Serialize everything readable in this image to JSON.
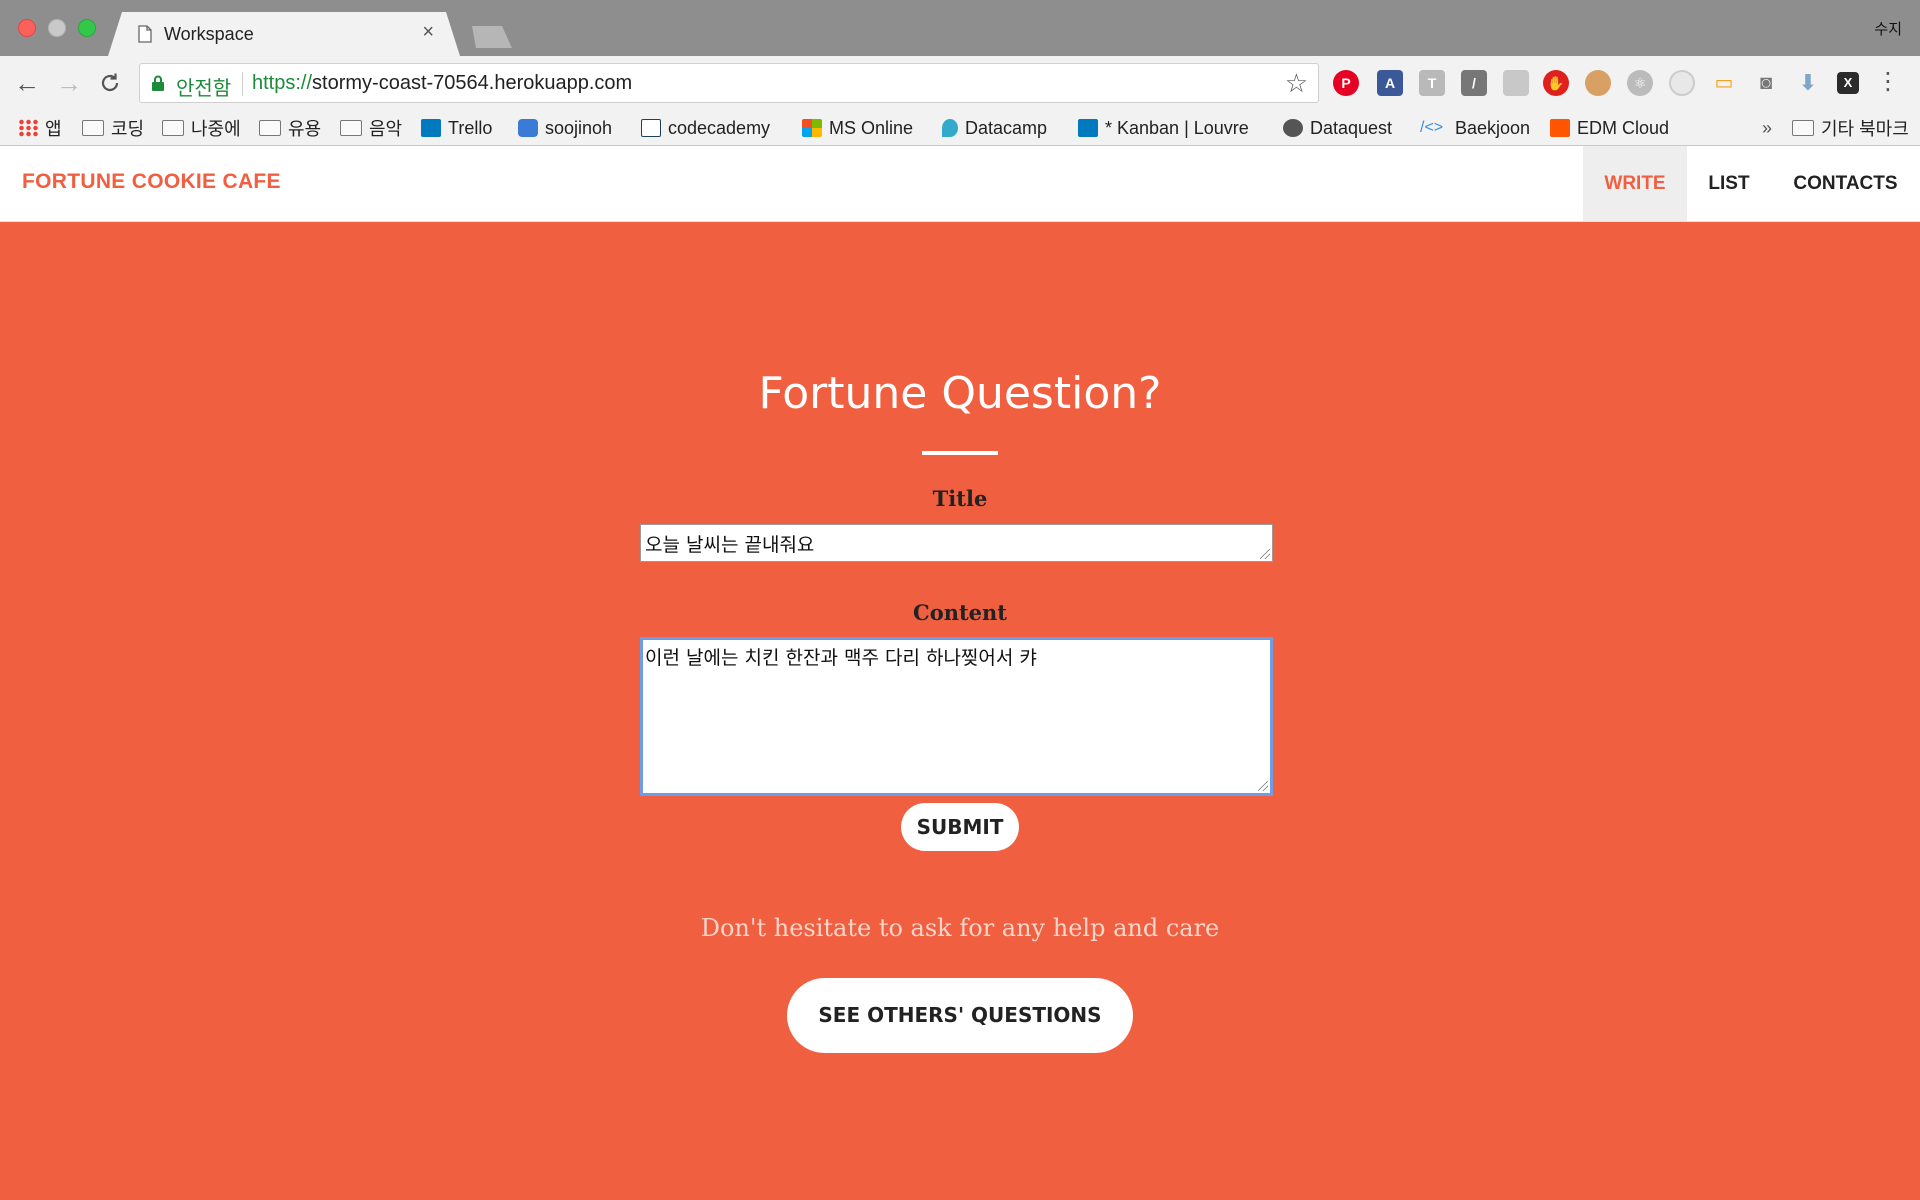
{
  "browser": {
    "tab_title": "Workspace",
    "tab_close": "×",
    "profile_name": "수지",
    "secure_label": "안전함",
    "url_scheme": "https://",
    "url_host": "stormy-coast-70564.herokuapp.com",
    "bookmarks": [
      {
        "label": "앱",
        "icon": "apps-grid-icon"
      },
      {
        "label": "코딩",
        "icon": "folder-icon"
      },
      {
        "label": "나중에",
        "icon": "folder-icon"
      },
      {
        "label": "유용",
        "icon": "folder-icon"
      },
      {
        "label": "음악",
        "icon": "folder-icon"
      },
      {
        "label": "Trello",
        "icon": "trello-icon"
      },
      {
        "label": "soojinoh",
        "icon": "cloud-icon"
      },
      {
        "label": "codecademy",
        "icon": "codecademy-icon"
      },
      {
        "label": "MS Online",
        "icon": "microsoft-icon"
      },
      {
        "label": "Datacamp",
        "icon": "datacamp-icon"
      },
      {
        "label": "* Kanban | Louvre",
        "icon": "trello-icon"
      },
      {
        "label": "Dataquest",
        "icon": "dataquest-icon"
      },
      {
        "label": "Baekjoon",
        "icon": "code-brackets-icon"
      },
      {
        "label": "EDM Cloud",
        "icon": "soundcloud-icon"
      }
    ],
    "bookmarks_more": "»",
    "other_bookmarks": "기타 북마크"
  },
  "site": {
    "brand": "FORTUNE COOKIE CAFE",
    "nav": [
      {
        "label": "WRITE",
        "active": true
      },
      {
        "label": "LIST",
        "active": false
      },
      {
        "label": "CONTACTS",
        "active": false
      }
    ],
    "heading": "Fortune Question?",
    "form": {
      "title_label": "Title",
      "title_value": "오늘 날씨는 끝내줘요",
      "content_label": "Content",
      "content_value": "이런 날에는 치킨 한잔과 맥주 다리 하나찢어서 캬",
      "submit_label": "SUBMIT"
    },
    "tagline": "Don't hesitate to ask for any help and care",
    "see_others_label": "SEE OTHERS' QUESTIONS"
  },
  "colors": {
    "accent": "#f05f40",
    "focus_ring": "#6d9de8",
    "secure_green": "#1c8b3a"
  }
}
